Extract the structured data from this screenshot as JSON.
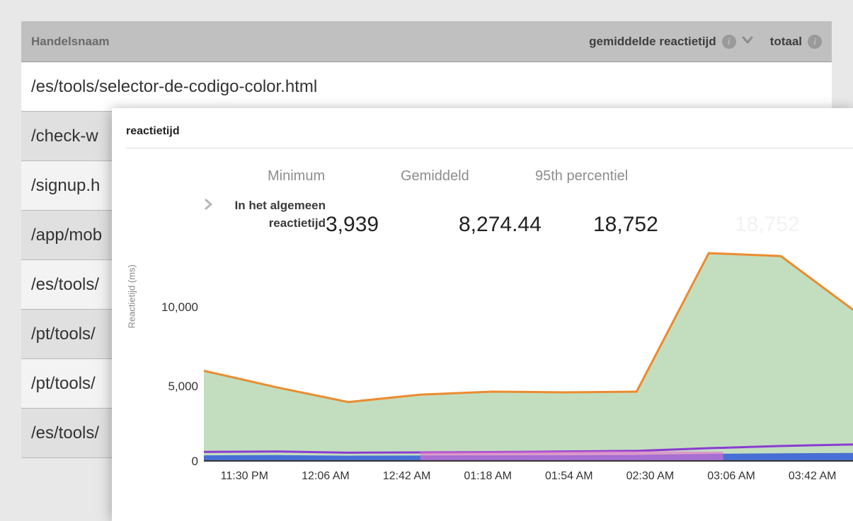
{
  "header": {
    "name_col": "Handelsnaam",
    "metric_label": "gemiddelde reactietijd",
    "total_label": "totaal"
  },
  "rows": [
    "/es/tools/selector-de-codigo-color.html",
    "/check-w",
    "/signup.h",
    "/app/mob",
    "/es/tools/",
    "/pt/tools/",
    "/pt/tools/",
    "/es/tools/"
  ],
  "popover": {
    "title": "reactietijd",
    "stat_heads": {
      "min": "Minimum",
      "avg": "Gemiddeld",
      "p95": "95th percentiel"
    },
    "overall_label_l1": "In het algemeen",
    "overall_label_l2": "reactietijd",
    "stats": {
      "min": "3,939",
      "avg": "8,274.44",
      "p95": "18,752",
      "ghost": "18,752"
    },
    "yaxis_label": "Reactietijd (ms)"
  },
  "chart_data": {
    "type": "area",
    "xlabel": "",
    "ylabel": "Reactietijd (ms)",
    "ylim": [
      0,
      15000
    ],
    "yticks": [
      0,
      5000,
      10000
    ],
    "ytick_labels": [
      "0",
      "5,000",
      "10,000"
    ],
    "categories": [
      "11:30 PM",
      "12:06 AM",
      "12:42 AM",
      "01:18 AM",
      "01:54 AM",
      "02:30 AM",
      "03:06 AM",
      "03:42 AM"
    ],
    "series": [
      {
        "name": "p95",
        "color": "#ec8b2f",
        "fill": "#b8d8b4",
        "values": [
          6100,
          5000,
          4000,
          4500,
          4700,
          4650,
          4700,
          14000,
          13800,
          10200
        ]
      },
      {
        "name": "avg",
        "color": "#8b3bd1",
        "fill": "none",
        "values": [
          650,
          680,
          600,
          620,
          640,
          680,
          720,
          900,
          1050,
          1150
        ]
      },
      {
        "name": "min",
        "color": "#3a63d6",
        "fill": "#3a63d6",
        "values": [
          420,
          440,
          400,
          410,
          420,
          430,
          450,
          520,
          560,
          580
        ]
      }
    ]
  }
}
